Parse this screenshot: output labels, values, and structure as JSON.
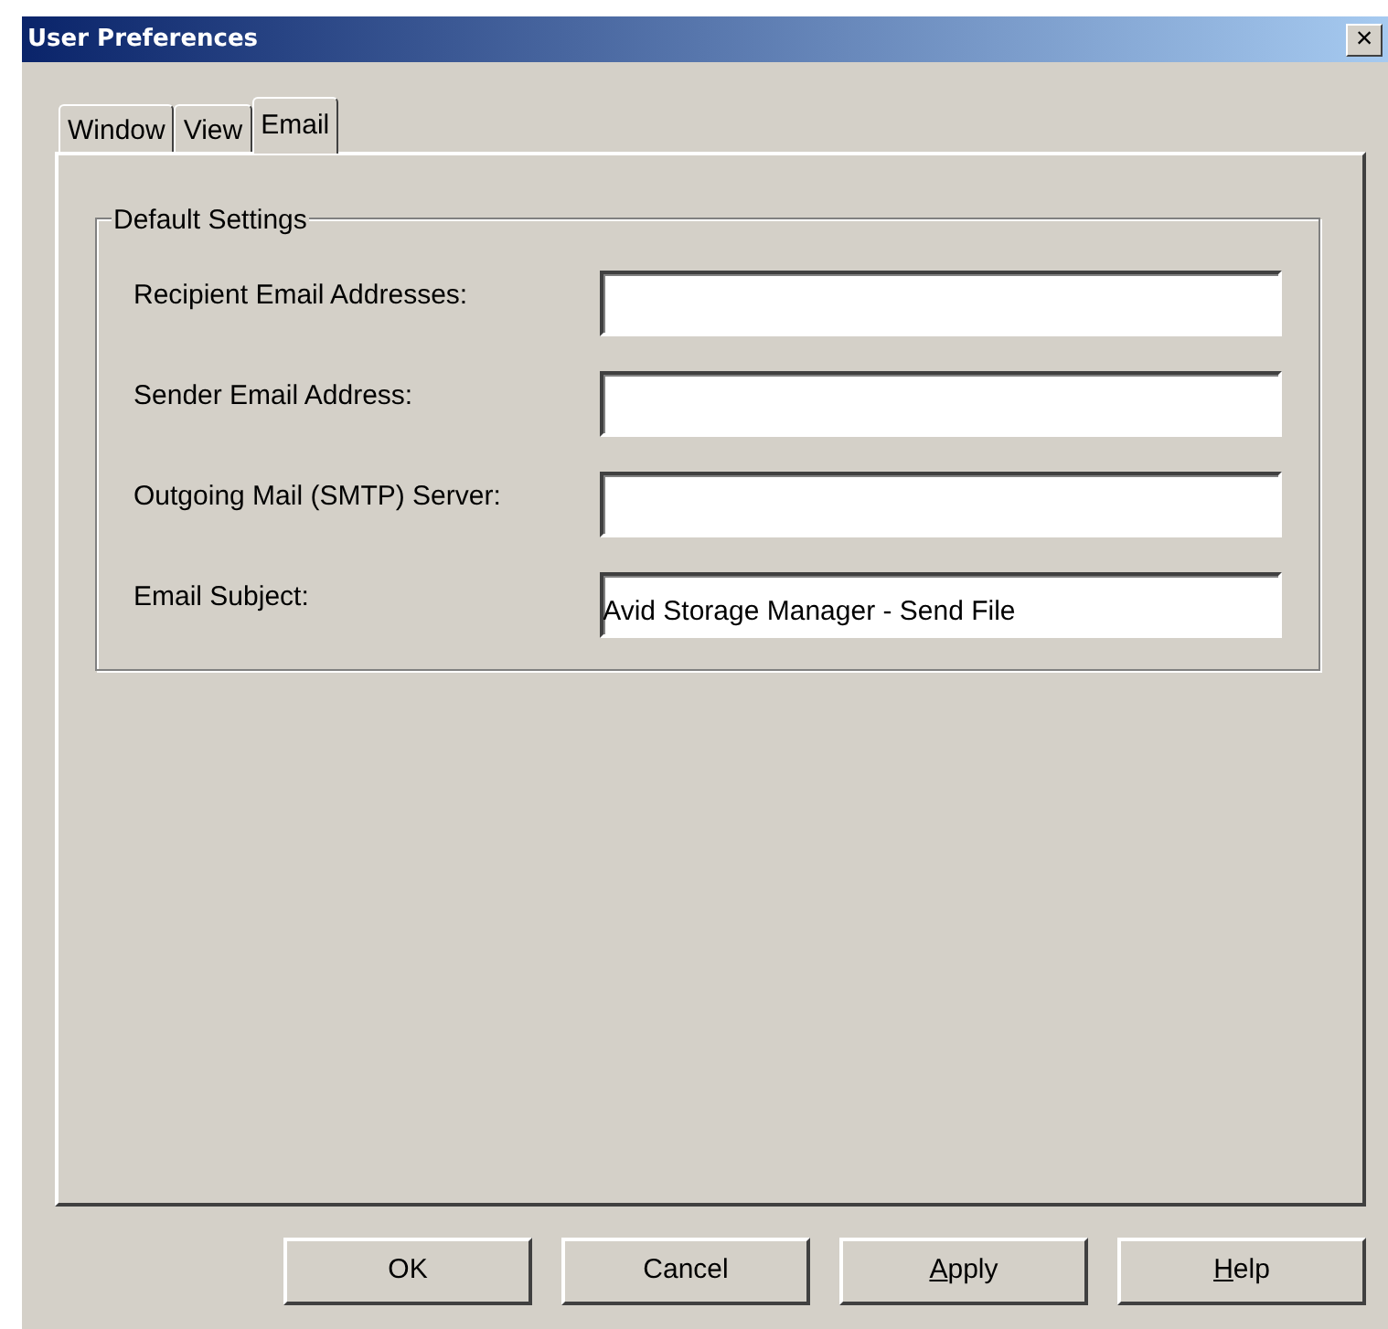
{
  "window": {
    "title": "User Preferences",
    "close_glyph": "×"
  },
  "tabs": [
    {
      "label": "Window",
      "selected": false
    },
    {
      "label": "View",
      "selected": false
    },
    {
      "label": "Email",
      "selected": true
    }
  ],
  "group": {
    "title": "Default Settings",
    "fields": [
      {
        "label": "Recipient Email Addresses:"
      },
      {
        "label": "Sender Email Address:"
      },
      {
        "label": "Outgoing Mail (SMTP) Server:"
      },
      {
        "label": "Email Subject:",
        "value": "Avid Storage Manager - Send File"
      }
    ]
  },
  "buttons": [
    {
      "label": "OK",
      "mnemonic_first": false
    },
    {
      "label": "Cancel",
      "mnemonic_first": false
    },
    {
      "label": "Apply",
      "mnemonic_first": true
    },
    {
      "label": "Help",
      "mnemonic_first": true
    }
  ]
}
